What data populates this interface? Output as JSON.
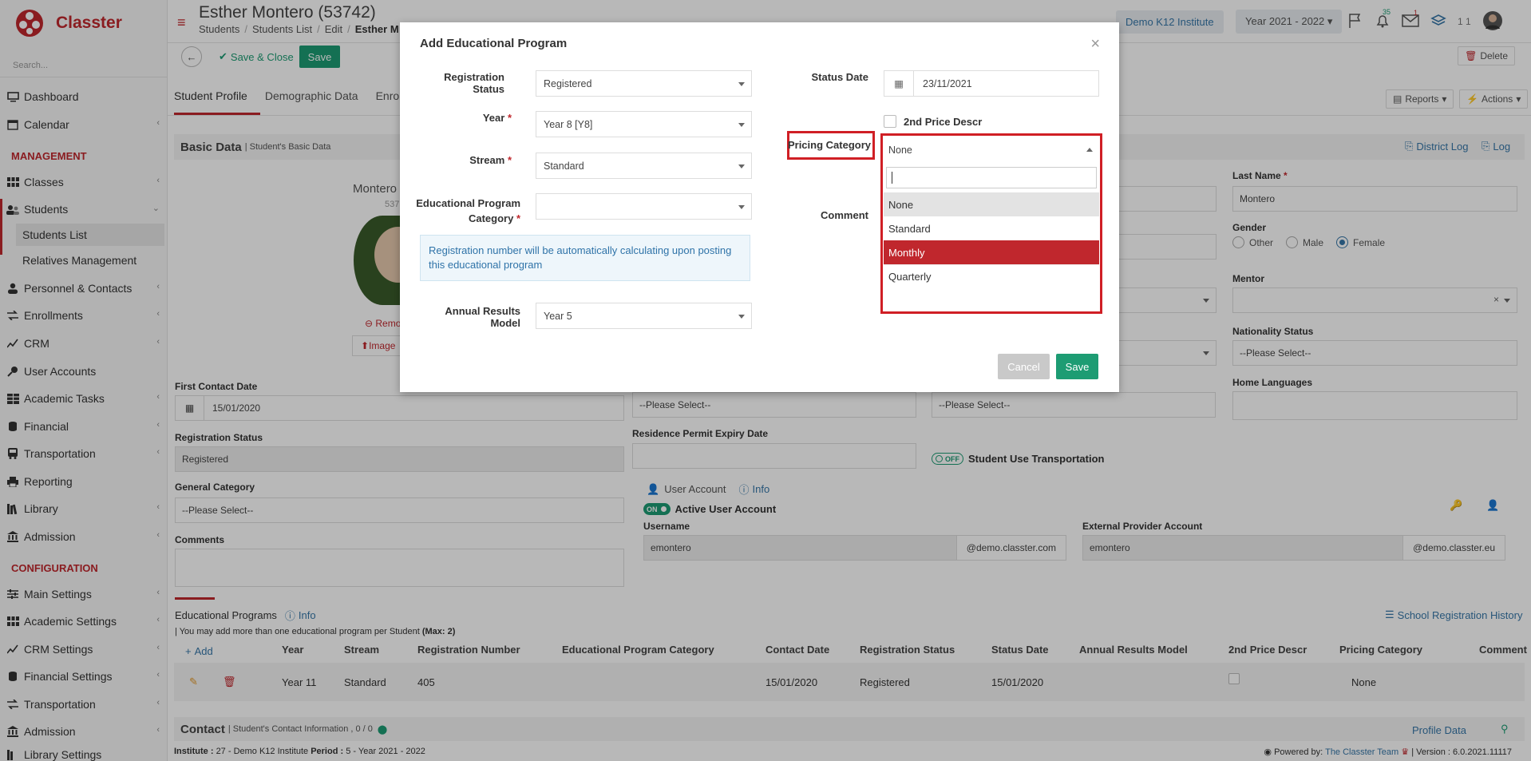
{
  "sidebar": {
    "brand": "Classter",
    "search_placeholder": "Search...",
    "items": [
      {
        "label": "Dashboard",
        "icon": "monitor-icon",
        "chevron": false
      },
      {
        "label": "Calendar",
        "icon": "calendar-icon",
        "chevron": true
      },
      {
        "label": "Classes",
        "icon": "grid-icon",
        "chevron": true
      },
      {
        "label": "Students",
        "icon": "users-icon",
        "chevron": true
      },
      {
        "label": "Personnel & Contacts",
        "icon": "person-icon",
        "chevron": true
      },
      {
        "label": "Enrollments",
        "icon": "arrows-icon",
        "chevron": true
      },
      {
        "label": "CRM",
        "icon": "chart-icon",
        "chevron": true
      },
      {
        "label": "User Accounts",
        "icon": "key-icon",
        "chevron": false
      },
      {
        "label": "Academic Tasks",
        "icon": "table-icon",
        "chevron": true
      },
      {
        "label": "Financial",
        "icon": "coins-icon",
        "chevron": true
      },
      {
        "label": "Transportation",
        "icon": "bus-icon",
        "chevron": true
      },
      {
        "label": "Reporting",
        "icon": "printer-icon",
        "chevron": false
      },
      {
        "label": "Library",
        "icon": "books-icon",
        "chevron": true
      },
      {
        "label": "Admission",
        "icon": "bank-icon",
        "chevron": true
      }
    ],
    "sections": {
      "management": "MANAGEMENT",
      "configuration": "CONFIGURATION"
    },
    "sub_items": [
      "Students List",
      "Relatives Management"
    ],
    "config_items": [
      "Main Settings",
      "Academic Settings",
      "CRM Settings",
      "Financial Settings",
      "Transportation",
      "Admission",
      "Library Settings"
    ]
  },
  "header": {
    "title": "Esther Montero (53742)",
    "breadcrumb": [
      "Students",
      "Students List",
      "Edit",
      "Esther M"
    ],
    "institute": "Demo K12 Institute",
    "year": "Year 2021 - 2022",
    "badge_notifications": "35",
    "badge_messages": "1",
    "user_count": "1 1"
  },
  "toolbar": {
    "save_close": "Save & Close",
    "save": "Save",
    "delete": "Delete"
  },
  "tabs": [
    "Student Profile",
    "Demographic Data",
    "Enroll"
  ],
  "tab_buttons": {
    "reports": "Reports",
    "actions": "Actions"
  },
  "basic": {
    "title": "Basic Data",
    "desc": "| Student's Basic Data",
    "district_log": "District Log",
    "log": "Log",
    "photo_name": "Montero",
    "photo_sub": "537",
    "remove": "Remo",
    "image": "Image",
    "last_name_label": "Last Name",
    "last_name": "Montero",
    "gender_label": "Gender",
    "gender_options": [
      "Other",
      "Male",
      "Female"
    ],
    "mentor_label": "Mentor",
    "nationality_label": "Nationality Status",
    "nationality_value": "--Please Select--",
    "home_lang_label": "Home Languages",
    "first_contact_label": "First Contact Date",
    "first_contact": "15/01/2020",
    "reg_status_label": "Registration Status",
    "reg_status": "Registered",
    "general_cat_label": "General Category",
    "please_select": "--Please Select--",
    "comments_label": "Comments",
    "residence_label": "Residence Permit Expiry Date",
    "transport_toggle": "OFF",
    "transport_label": "Student Use Transportation",
    "user_account": "User Account",
    "info": "Info",
    "active_toggle": "ON",
    "active_label": "Active User Account",
    "username_label": "Username",
    "username": "emontero",
    "username_domain": "@demo.classter.com",
    "ext_label": "External Provider Account",
    "ext_user": "emontero",
    "ext_domain": "@demo.classter.eu"
  },
  "programs": {
    "title": "Educational Programs",
    "info": "Info",
    "history": "School Registration History",
    "note": "| You may add more than one educational program per Student",
    "max": "(Max: 2)",
    "add": "Add",
    "columns": [
      "Year",
      "Stream",
      "Registration Number",
      "Educational Program Category",
      "Contact Date",
      "Registration Status",
      "Status Date",
      "Annual Results Model",
      "2nd Price Descr",
      "Pricing Category",
      "Comment"
    ],
    "row": {
      "year": "Year 11",
      "stream": "Standard",
      "reg_number": "405",
      "contact_date": "15/01/2020",
      "status": "Registered",
      "status_date": "15/01/2020",
      "pricing": "None"
    }
  },
  "contact": {
    "title": "Contact",
    "desc": "| Student's Contact Information , 0 / 0",
    "profile": "Profile Data"
  },
  "footer": {
    "institute_label": "Institute :",
    "institute": "27 - Demo K12 Institute",
    "period_label": "Period :",
    "period": "5 - Year 2021 - 2022",
    "powered": "Powered by:",
    "team": "The Classter Team",
    "version": "| Version : 6.0.2021.11117"
  },
  "modal": {
    "title": "Add Educational Program",
    "reg_status_label": "Registration Status",
    "reg_status": "Registered",
    "year_label": "Year",
    "year": "Year 8 [Y8]",
    "stream_label": "Stream",
    "stream": "Standard",
    "epc_label_1": "Educational Program",
    "epc_label_2": "Category",
    "epc": "",
    "info": "Registration number will be automatically calculating upon posting this educational program",
    "arm_label": "Annual Results Model",
    "arm": "Year 5",
    "status_date_label": "Status Date",
    "status_date": "23/11/2021",
    "second_price_label": "2nd Price Descr",
    "pricing_label": "Pricing Category",
    "pricing_value": "None",
    "comment_label": "Comment",
    "options": [
      "None",
      "Standard",
      "Monthly",
      "Quarterly"
    ],
    "cancel": "Cancel",
    "save": "Save"
  },
  "colors": {
    "brand_red": "#c0272d",
    "green": "#1d9c73",
    "blue_link": "#3677a8",
    "highlight": "#c0272d"
  }
}
